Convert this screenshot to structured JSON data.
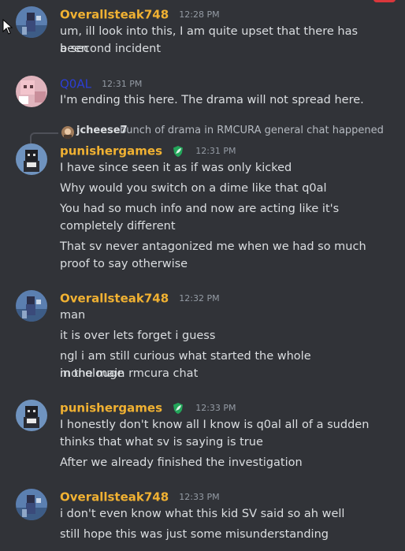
{
  "messages": [
    {
      "username": "Overallsteak748",
      "color": "#f0b132",
      "timestamp": "12:28 PM",
      "avatar": "minecraft-avatar-blue",
      "lines": [
        "um, ill look into this, I am quite upset that there has been",
        "a second incident"
      ]
    },
    {
      "username": "Q0AL",
      "color": "#2c3ed5",
      "timestamp": "12:31 PM",
      "avatar": "pink-pig-avatar",
      "lines": [
        "I'm ending this here. The drama will not spread here."
      ]
    },
    {
      "reply": {
        "username": "jcheese7",
        "text": "bunch of drama in RMCURA general chat happened"
      },
      "username": "punishergames",
      "color": "#f0b132",
      "badge": "shield-leaf-icon",
      "timestamp": "12:31 PM",
      "avatar": "minecraft-avatar-dark",
      "lines": [
        "I have since seen it as if was only kicked",
        "Why would you switch on a dime like that q0al",
        "You had so much info and now are acting like it's",
        "completely different",
        "That sv never antagonized me when we had so much",
        "proof to say otherwise"
      ]
    },
    {
      "username": "Overallsteak748",
      "color": "#f0b132",
      "timestamp": "12:32 PM",
      "avatar": "minecraft-avatar-blue",
      "lines": [
        "man",
        "it is over lets forget i guess",
        "ngl i am still curious what started the whole monolouge",
        "in the main rmcura chat"
      ]
    },
    {
      "username": "punishergames",
      "color": "#f0b132",
      "badge": "shield-leaf-icon",
      "timestamp": "12:33 PM",
      "avatar": "minecraft-avatar-dark",
      "lines": [
        "I honestly don't know all I know is q0al all of a sudden",
        "thinks that what sv is saying is true",
        "After we already finished the investigation"
      ]
    },
    {
      "username": "Overallsteak748",
      "color": "#f0b132",
      "timestamp": "12:33 PM",
      "avatar": "minecraft-avatar-blue",
      "lines": [
        "i don't even know what this kid SV said so ah well",
        "still hope this was just some misunderstanding"
      ]
    }
  ]
}
